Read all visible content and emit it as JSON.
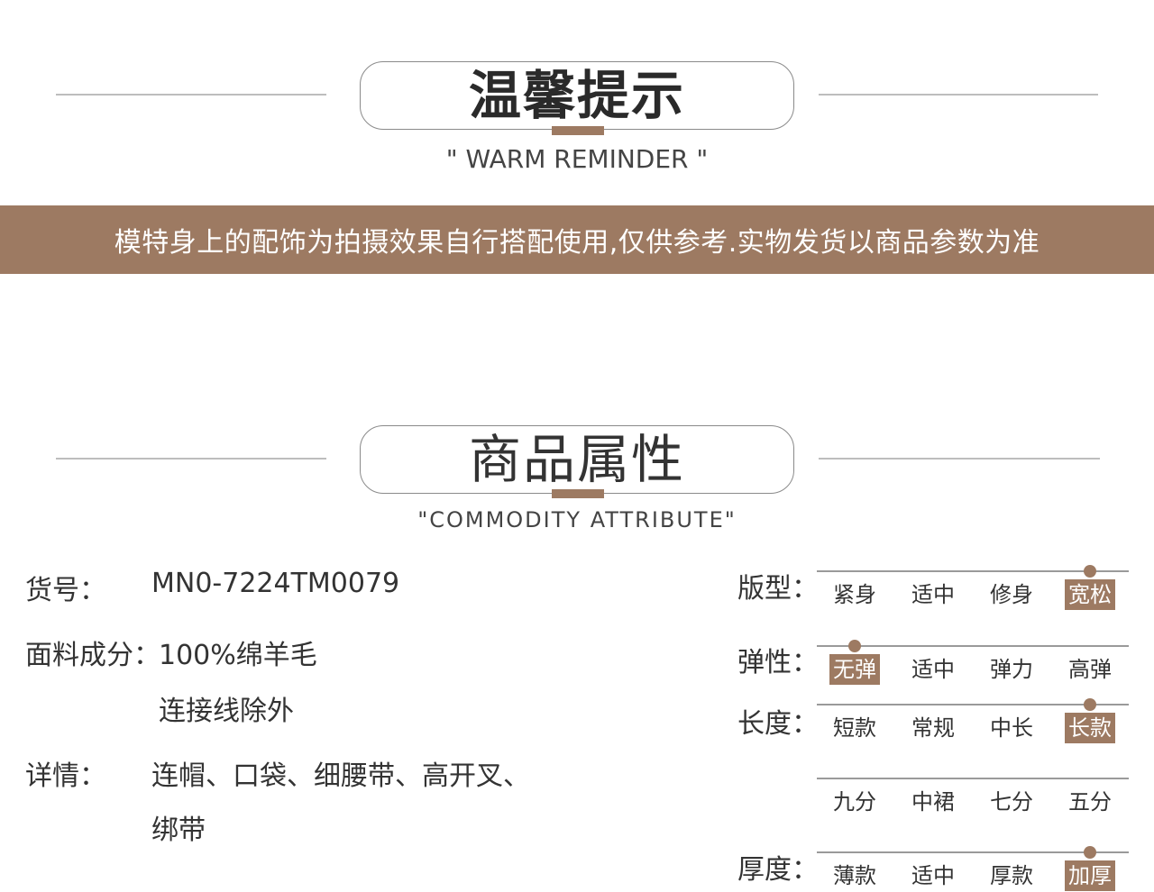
{
  "reminder": {
    "title": "温馨提示",
    "subtitle": "\" WARM REMINDER \""
  },
  "banner": {
    "text": "模特身上的配饰为拍摄效果自行搭配使用,仅供参考.实物发货以商品参数为准"
  },
  "attributes_header": {
    "title": "商品属性",
    "subtitle": "\"COMMODITY ATTRIBUTE\""
  },
  "product": {
    "sku_label": "货号：",
    "sku_value": "MN0-7224TM0079",
    "fabric_label": "面料成分：",
    "fabric_value": "100%绵羊毛",
    "fabric_note": "连接线除外",
    "details_label": "详情：",
    "details_line1": "连帽、口袋、细腰带、高开叉、",
    "details_line2": "绑带"
  },
  "scales": {
    "fit": {
      "label": "版型：",
      "options": [
        "紧身",
        "适中",
        "修身",
        "宽松"
      ],
      "selected": 3
    },
    "elasticity": {
      "label": "弹性：",
      "options": [
        "无弹",
        "适中",
        "弹力",
        "高弹"
      ],
      "selected": 0
    },
    "length": {
      "label": "长度：",
      "options": [
        "短款",
        "常规",
        "中长",
        "长款"
      ],
      "selected": 3,
      "options_row2": [
        "九分",
        "中裙",
        "七分",
        "五分"
      ]
    },
    "thickness": {
      "label": "厚度：",
      "options": [
        "薄款",
        "适中",
        "厚款",
        "加厚"
      ],
      "selected": 3
    }
  },
  "colors": {
    "accent": "#9d7a62",
    "text": "#333333",
    "line": "#bdbdbd"
  }
}
